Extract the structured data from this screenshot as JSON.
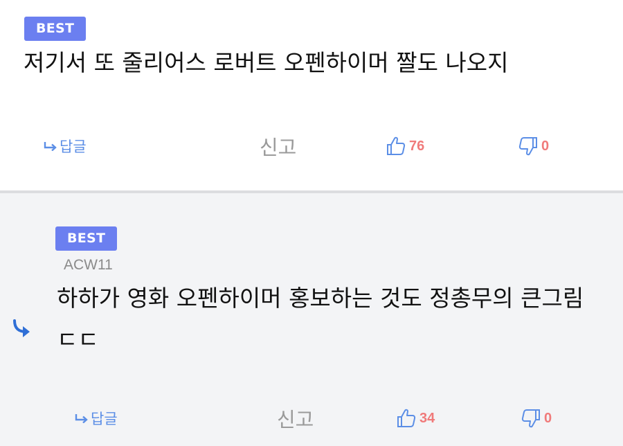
{
  "comments": [
    {
      "badge": "BEST",
      "author": "",
      "text": "저기서 또 줄리어스 로버트 오펜하이머 짤도 나오지",
      "actions": {
        "reply_label": "답글",
        "report_label": "신고",
        "likes": "76",
        "dislikes": "0"
      }
    },
    {
      "badge": "BEST",
      "author": "ACW11",
      "text": "하하가 영화 오펜하이머 홍보하는 것도 정총무의 큰그림 ㄷㄷ",
      "actions": {
        "reply_label": "답글",
        "report_label": "신고",
        "likes": "34",
        "dislikes": "0"
      }
    }
  ],
  "colors": {
    "badge": "#6b7ff0",
    "reply": "#5b8ee6",
    "report": "#9a9a9a",
    "count": "#f07a7a",
    "reply_arrow": "#2f6fd6",
    "nested_bg": "#f3f4f6"
  },
  "icons": {
    "reply": "reply-arrow-icon",
    "like": "thumbs-up-icon",
    "dislike": "thumbs-down-icon",
    "nested": "nested-reply-arrow-icon"
  }
}
